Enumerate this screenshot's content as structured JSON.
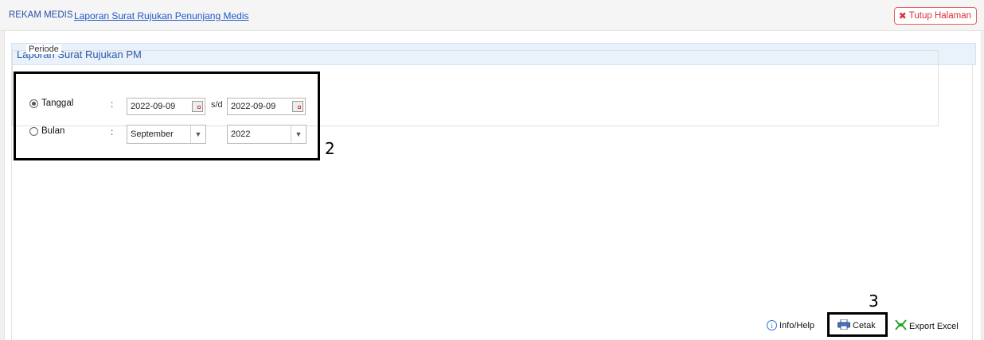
{
  "header": {
    "root": "REKAM MEDIS",
    "current": "Laporan Surat Rujukan Penunjang Medis",
    "close_label": "Tutup Halaman"
  },
  "panel": {
    "title": "Laporan Surat Rujukan PM"
  },
  "periode": {
    "legend": "Periode",
    "tanggal": {
      "label": "Tanggal",
      "selected": true,
      "from": "2022-09-09",
      "separator": "s/d",
      "to": "2022-09-09"
    },
    "bulan": {
      "label": "Bulan",
      "selected": false,
      "month": "September",
      "year": "2022"
    },
    "colon": ":"
  },
  "callouts": {
    "periode_number": "2",
    "cetak_number": "3"
  },
  "actions": {
    "info": "Info/Help",
    "print": "Cetak",
    "export": "Export Excel"
  },
  "colors": {
    "accent": "#2a5ca8",
    "danger": "#d9313a"
  }
}
